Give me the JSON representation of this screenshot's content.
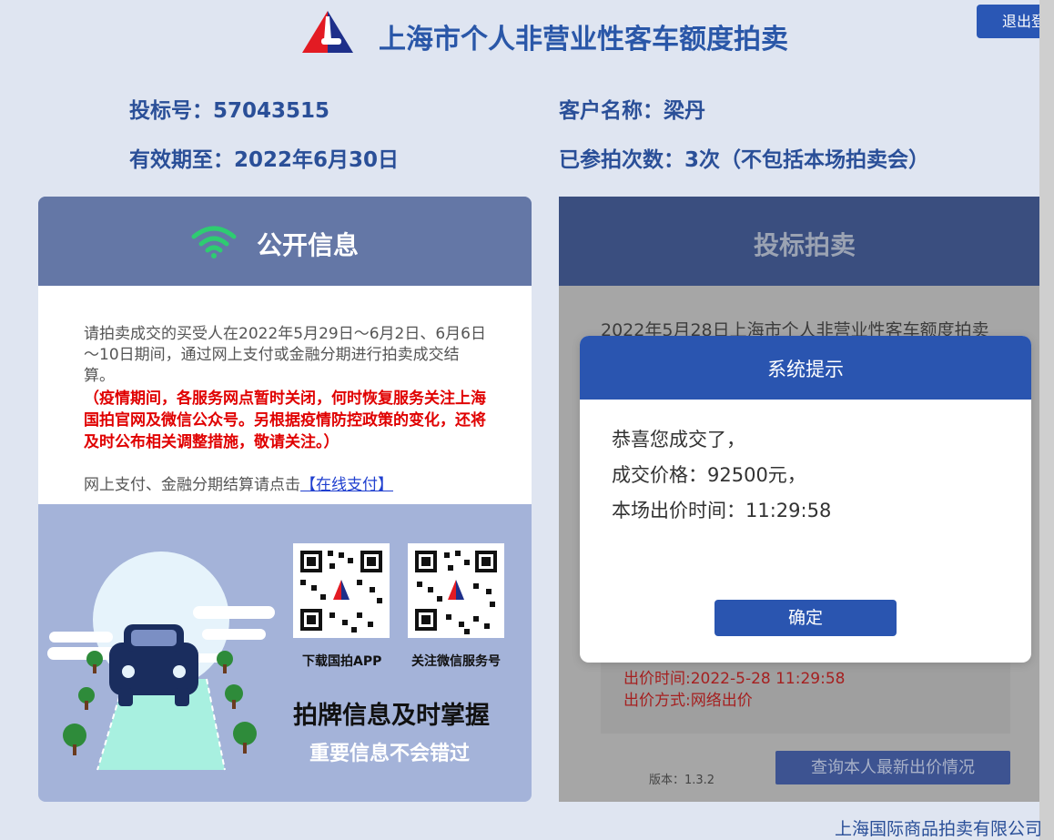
{
  "header": {
    "title": "上海市个人非营业性客车额度拍卖",
    "logout_label": "退出登"
  },
  "info": {
    "bid_no_label": "投标号：",
    "bid_no": "57043515",
    "customer_label": "客户名称：",
    "customer": "梁丹",
    "valid_label": "有效期至：",
    "valid_until": "2022年6月30日",
    "count_label": "已参拍次数：",
    "count": "3次（不包括本场拍卖会）"
  },
  "public_info": {
    "title": "公开信息",
    "text1": "请拍卖成交的买受人在2022年5月29日～6月2日、6月6日～10日期间，通过网上支付或金融分期进行拍卖成交结算。",
    "notice": "（疫情期间，各服务网点暂时关闭，何时恢复服务关注上海国拍官网及微信公众号。另根据疫情防控政策的变化，还将及时公布相关调整措施，敬请关注。）",
    "pay_text": "网上支付、金融分期结算请点击",
    "pay_link": "【在线支付】",
    "qr1_label": "下载国拍APP",
    "qr2_label": "关注微信服务号",
    "promo_main": "拍牌信息及时掌握",
    "promo_sub": "重要信息不会错过"
  },
  "bidding": {
    "title": "投标拍卖",
    "line1": "2022年5月28日上海市个人非营业性客车额度拍卖",
    "bid_time": "出价时间:2022-5-28 11:29:58",
    "bid_method": "出价方式:网络出价",
    "version": "版本：1.3.2",
    "query_button": "查询本人最新出价情况"
  },
  "modal": {
    "title": "系统提示",
    "line1": "恭喜您成交了，",
    "line2": "成交价格：92500元，",
    "line3": "本场出价时间：11:29:58",
    "ok_button": "确定"
  },
  "footer": {
    "company": "上海国际商品拍卖有限公司"
  },
  "colors": {
    "primary": "#2a55b0",
    "left_header": "#6477a6",
    "right_header": "#3a4e7f",
    "notice_red": "#e00000",
    "wifi_green": "#2ecc71"
  }
}
